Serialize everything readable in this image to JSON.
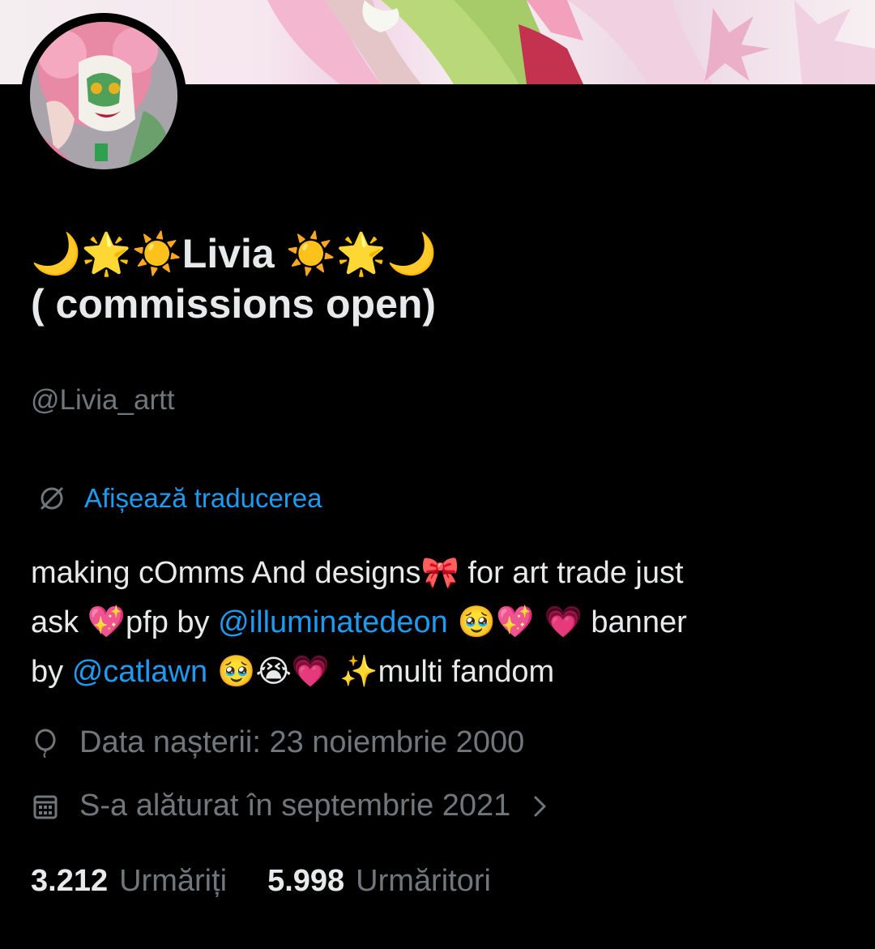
{
  "profile": {
    "name_line1": {
      "prefix_emojis": "🌙🌟☀️",
      "name": "Livia",
      "suffix_emojis": "☀️🌟🌙"
    },
    "name_line2": "( commissions open)",
    "handle": "@Livia_artt"
  },
  "translate": {
    "label": "Afișează traducerea"
  },
  "bio": {
    "line1": {
      "text1": "making cOmms And designs",
      "emoji1": "🎀",
      "text2": " for art trade just"
    },
    "line2": {
      "text1": "ask ",
      "emoji1": "💖",
      "text2": "pfp by ",
      "mention": "@illuminatedeon",
      "emoji2": " 🥹💖 💗",
      "text3": " banner"
    },
    "line3": {
      "text1": "by ",
      "mention": "@catlawn",
      "emoji1": " 🥹😭💗 ✨",
      "text2": "multi fandom"
    }
  },
  "meta": {
    "birth_date": "Data nașterii: 23 noiembrie 2000",
    "joined": "S-a alăturat în septembrie 2021"
  },
  "stats": {
    "following_count": "3.212",
    "following_label": "Urmăriți",
    "followers_count": "5.998",
    "followers_label": "Urmăritori"
  },
  "colors": {
    "background": "#000000",
    "text": "#e7e9ea",
    "muted": "#71767b",
    "link": "#1d9bf0"
  }
}
